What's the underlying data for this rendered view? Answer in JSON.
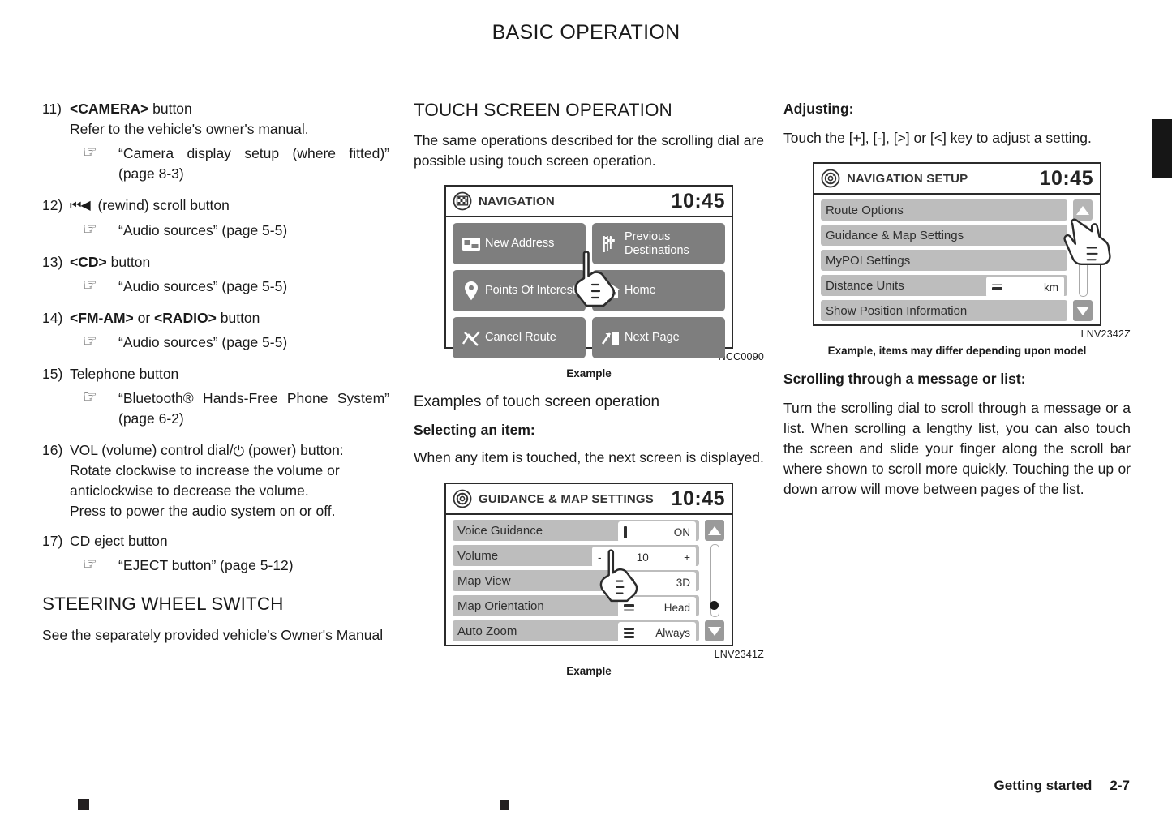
{
  "header": {
    "title": "BASIC OPERATION"
  },
  "footer": {
    "section": "Getting started",
    "page": "2-7"
  },
  "left_column": {
    "items": [
      {
        "num": "11)",
        "title_bold": "<CAMERA>",
        "title_rest": " button",
        "sub": "Refer to the vehicle's owner's manual.",
        "ref": "“Camera display setup (where fitted)” (page 8-3)"
      },
      {
        "num": "12)",
        "icon": "rewind-icon",
        "title_rest": "(rewind) scroll button",
        "ref": "“Audio sources” (page 5-5)"
      },
      {
        "num": "13)",
        "title_bold": "<CD>",
        "title_rest": " button",
        "ref": "“Audio sources” (page 5-5)"
      },
      {
        "num": "14)",
        "title_bold": "<FM-AM>",
        "title_mid": " or ",
        "title_bold2": "<RADIO>",
        "title_rest": " button",
        "ref": "“Audio sources” (page 5-5)"
      },
      {
        "num": "15)",
        "title_rest": "Telephone button",
        "ref": "“Bluetooth® Hands-Free Phone System” (page 6-2)"
      },
      {
        "num": "16)",
        "title_rest": "VOL (volume) control dial/",
        "icon2": "power-icon",
        "title_rest2": " (power) button:",
        "sub": "Rotate clockwise to increase the volume or anticlockwise to decrease the volume.",
        "sub2": "Press to power the audio system on or off."
      },
      {
        "num": "17)",
        "title_rest": "CD eject button",
        "ref": "“EJECT button” (page 5-12)"
      }
    ],
    "heading": "STEERING WHEEL SWITCH",
    "heading_body": "See the separately provided vehicle's Owner's Manual"
  },
  "mid_column": {
    "heading": "TOUCH SCREEN OPERATION",
    "intro": "The same operations described for the scrolling dial are possible using touch screen operation.",
    "figure1": {
      "code": "NCC0090",
      "caption": "Example",
      "screen": {
        "icon": "checkered-flag-icon",
        "title": "NAVIGATION",
        "clock": "10:45",
        "buttons": [
          {
            "label": "New Address",
            "icon": "address-card-icon"
          },
          {
            "label": "Previous Destinations",
            "icon": "flags-icon"
          },
          {
            "label": "Points Of Interest",
            "icon": "map-pin-icon"
          },
          {
            "label": "Home",
            "icon": "home-icon"
          },
          {
            "label": "Cancel Route",
            "icon": "cancel-route-icon"
          },
          {
            "label": "Next Page",
            "icon": "next-page-icon"
          }
        ]
      }
    },
    "heading2": "Examples of touch screen operation",
    "heading3": "Selecting an item:",
    "body2": "When any item is touched, the next screen is displayed.",
    "figure2": {
      "code": "LNV2341Z",
      "caption": "Example",
      "screen": {
        "icon": "gear-icon",
        "title": "GUIDANCE & MAP SETTINGS",
        "clock": "10:45",
        "rows": [
          {
            "label": "Voice Guidance",
            "value": "ON",
            "indicator": "single-bar"
          },
          {
            "label": "Volume",
            "value": "10",
            "minus": "-",
            "plus": "+"
          },
          {
            "label": "Map View",
            "value": "3D",
            "indicator": "two-bar"
          },
          {
            "label": "Map Orientation",
            "value": "Head",
            "indicator": "two-bar"
          },
          {
            "label": "Auto Zoom",
            "value": "Always",
            "indicator": "three-bar"
          }
        ]
      }
    }
  },
  "right_column": {
    "heading1": "Adjusting:",
    "body1": "Touch the [+], [-], [>] or [<] key to adjust a setting.",
    "figure3": {
      "code": "LNV2342Z",
      "caption": "Example, items may differ depending upon model",
      "screen": {
        "icon": "gear-icon",
        "title": "NAVIGATION SETUP",
        "clock": "10:45",
        "rows": [
          {
            "label": "Route Options"
          },
          {
            "label": "Guidance & Map Settings"
          },
          {
            "label": "MyPOI Settings"
          },
          {
            "label": "Distance Units",
            "value": "km",
            "indicator": "two-bar"
          },
          {
            "label": "Show Position Information"
          }
        ]
      }
    },
    "heading2": "Scrolling through a message or list:",
    "body2": "Turn the scrolling dial to scroll through a message or a list. When scrolling a lengthy list, you can also touch the screen and slide your finger along the scroll bar where shown to scroll more quickly. Touching the up or down arrow will move between pages of the list."
  }
}
